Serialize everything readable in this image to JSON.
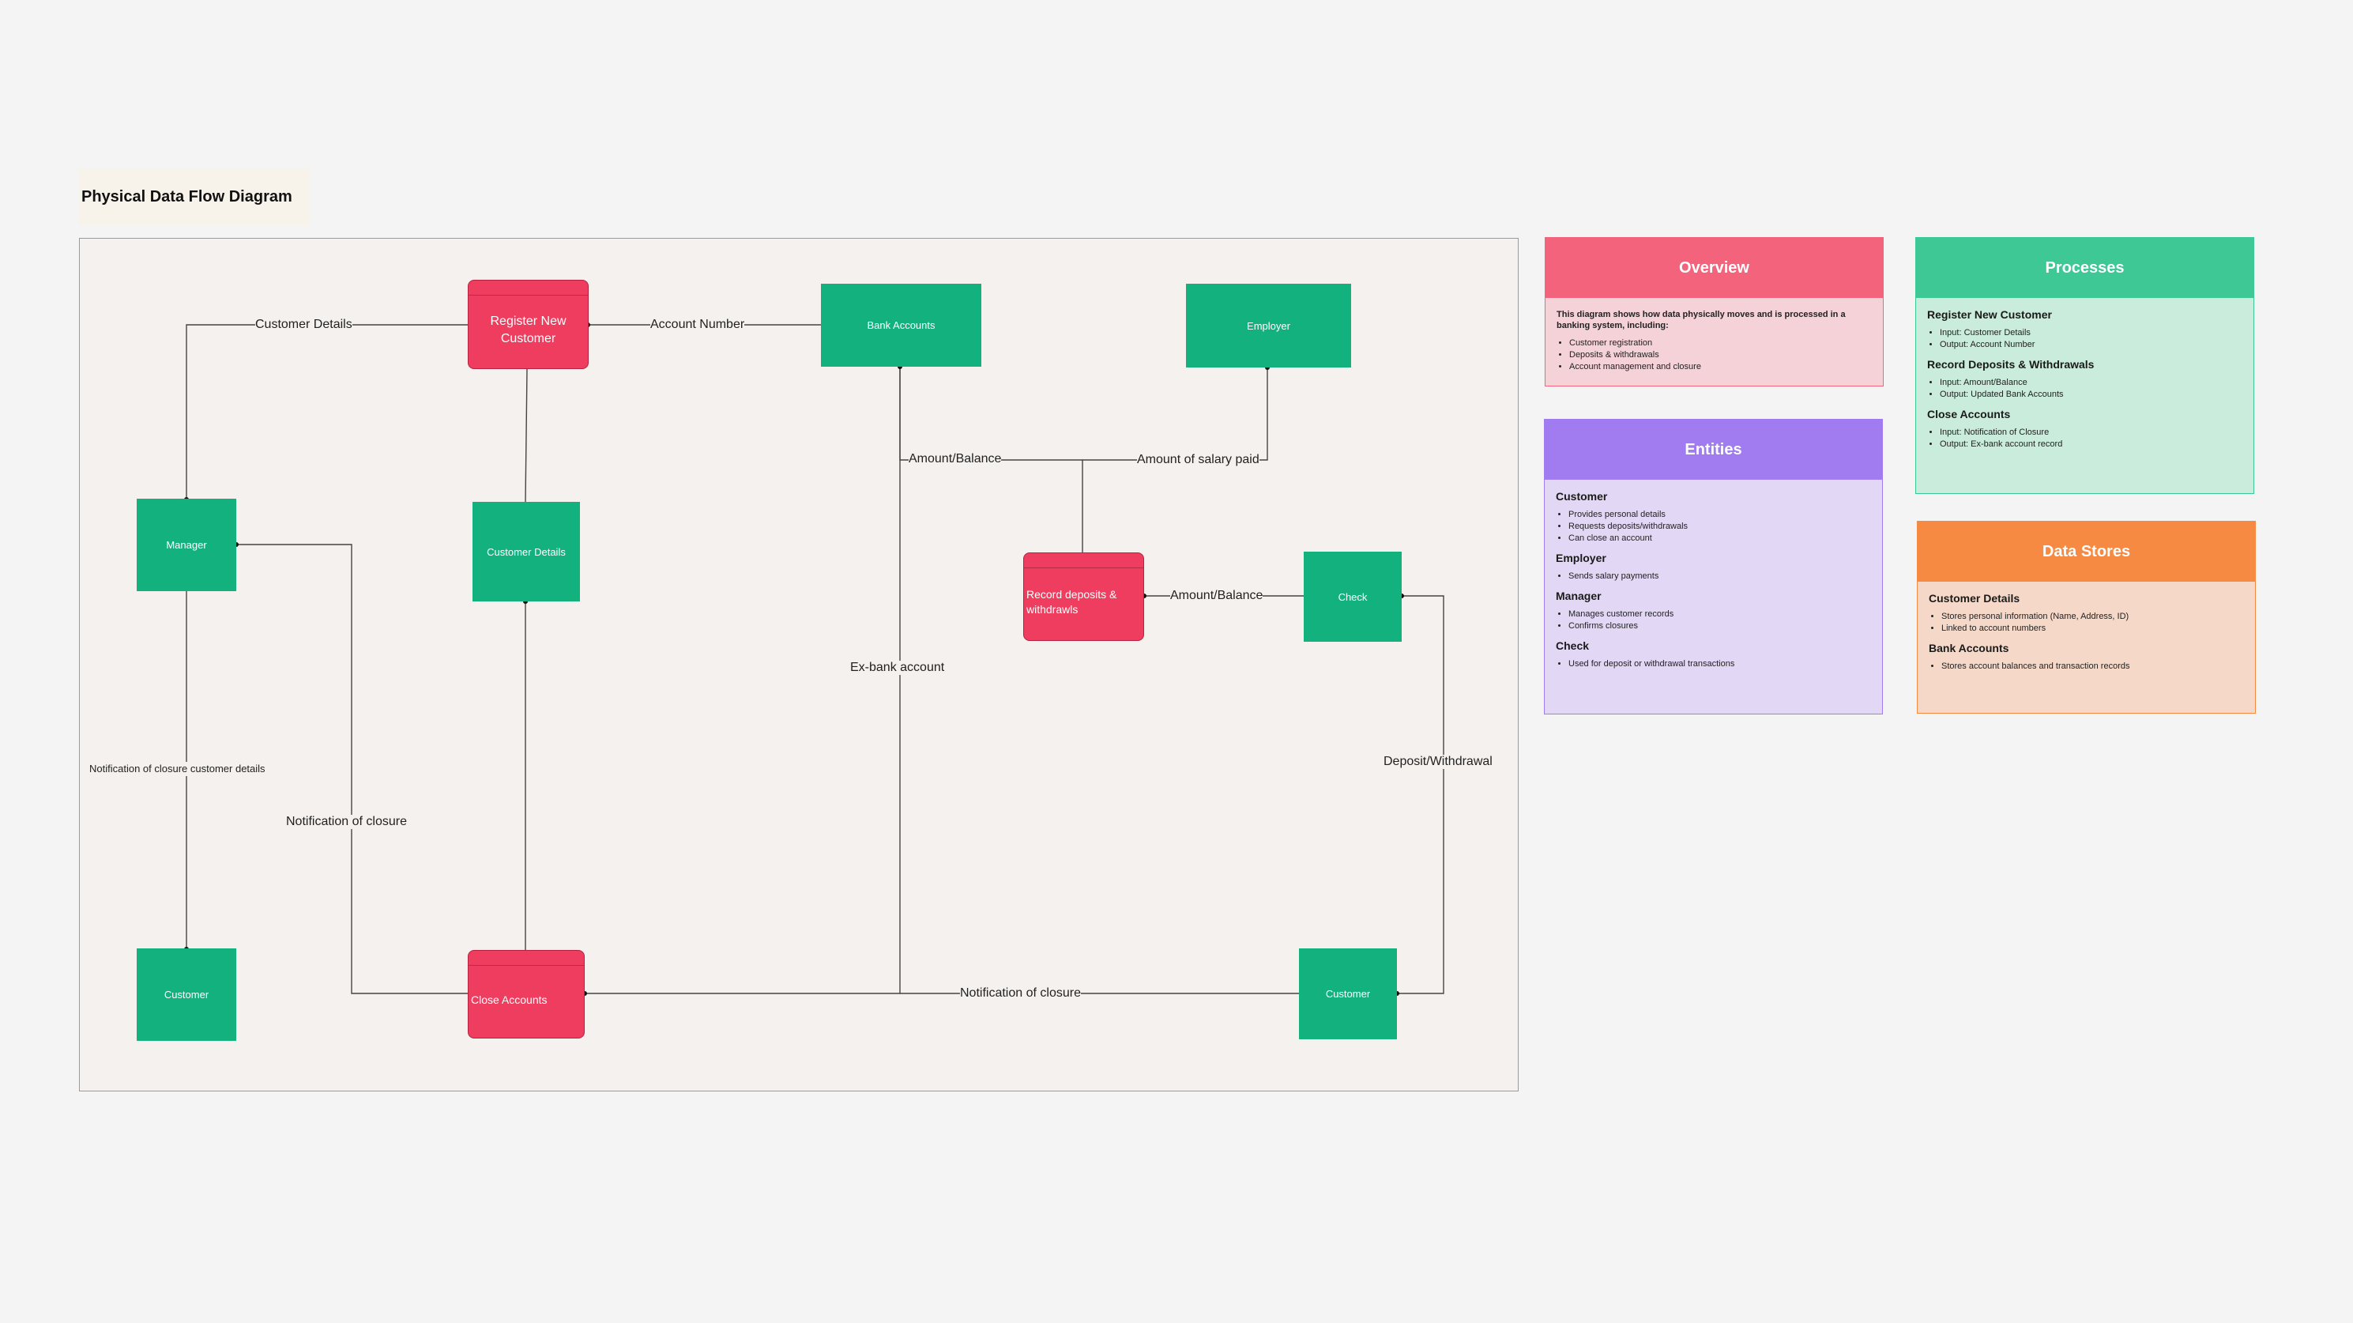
{
  "diagram": {
    "title": "Physical Data Flow Diagram",
    "nodes": {
      "register": "Register New Customer",
      "bank_accounts": "Bank Accounts",
      "employer": "Employer",
      "manager": "Manager",
      "customer_details": "Customer Details",
      "record": "Record deposits & withdrawls",
      "check": "Check",
      "customer_left": "Customer",
      "close_accounts": "Close Accounts",
      "customer_right": "Customer"
    },
    "edges": {
      "customer_details": "Customer Details",
      "account_number": "Account Number",
      "amount_balance_top": "Amount/Balance",
      "salary": "Amount of salary paid",
      "amount_balance_mid": "Amount/Balance",
      "ex_bank": "Ex-bank account",
      "closure_customer_details": "Notification of closure customer details",
      "notification_closure_left": "Notification of closure",
      "deposit_withdrawal": "Deposit/Withdrawal",
      "notification_closure_bottom": "Notification of closure"
    }
  },
  "colors": {
    "entity": "#13b17e",
    "process": "#ee3d5e",
    "overview": "#f3637c",
    "entities": "#a17bf0",
    "processes": "#3ec895",
    "data_stores": "#f68a42"
  },
  "cards": {
    "overview": {
      "title": "Overview",
      "intro": "This diagram shows how data physically moves and is processed in a banking system, including:",
      "items": [
        "Customer registration",
        "Deposits & withdrawals",
        "Account management and closure"
      ]
    },
    "processes": {
      "title": "Processes",
      "groups": [
        {
          "heading": "Register New Customer",
          "items": [
            "Input: Customer Details",
            "Output: Account Number"
          ]
        },
        {
          "heading": "Record Deposits & Withdrawals",
          "items": [
            "Input: Amount/Balance",
            "Output: Updated Bank Accounts"
          ]
        },
        {
          "heading": "Close Accounts",
          "items": [
            "Input: Notification of Closure",
            "Output: Ex-bank account record"
          ]
        }
      ]
    },
    "entities": {
      "title": "Entities",
      "groups": [
        {
          "heading": "Customer",
          "items": [
            "Provides personal details",
            "Requests deposits/withdrawals",
            "Can close an account"
          ]
        },
        {
          "heading": "Employer",
          "items": [
            "Sends salary payments"
          ]
        },
        {
          "heading": "Manager",
          "items": [
            "Manages customer records",
            "Confirms closures"
          ]
        },
        {
          "heading": "Check",
          "items": [
            "Used for deposit or withdrawal transactions"
          ]
        }
      ]
    },
    "data_stores": {
      "title": "Data Stores",
      "groups": [
        {
          "heading": "Customer Details",
          "items": [
            "Stores personal information (Name, Address, ID)",
            "Linked to account numbers"
          ]
        },
        {
          "heading": "Bank Accounts",
          "items": [
            "Stores account balances and transaction records"
          ]
        }
      ]
    }
  }
}
